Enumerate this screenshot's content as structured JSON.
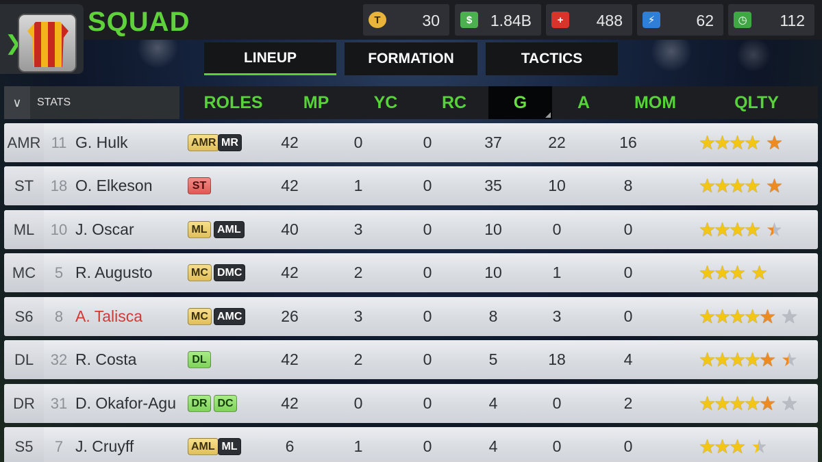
{
  "header": {
    "title": "SQUAD",
    "back_icon": "chevron-right-icon",
    "resources": [
      {
        "icon": "token-icon",
        "value": "30",
        "color": "#e8b53a"
      },
      {
        "icon": "cash-icon",
        "value": "1.84B",
        "color": "#4caf50"
      },
      {
        "icon": "medical-icon",
        "value": "488",
        "color": "#d9342b"
      },
      {
        "icon": "energy-icon",
        "value": "62",
        "color": "#2f7fd8"
      },
      {
        "icon": "training-icon",
        "value": "112",
        "color": "#3fa845"
      }
    ]
  },
  "tabs": [
    {
      "label": "LINEUP",
      "active": true
    },
    {
      "label": "FORMATION",
      "active": false
    },
    {
      "label": "TACTICS",
      "active": false
    }
  ],
  "stats_toggle": {
    "label": "STATS",
    "icon": "chevron-down-icon"
  },
  "columns": [
    "ROLES",
    "MP",
    "YC",
    "RC",
    "G",
    "A",
    "MOM",
    "QLTY"
  ],
  "sorted_column": "G",
  "players": [
    {
      "pos": "AMR",
      "num": "11",
      "name": "G. Hulk",
      "highlight": false,
      "roles": [
        {
          "label": "AMR",
          "style": "yellow"
        },
        {
          "label": "MR",
          "style": "dark"
        }
      ],
      "mp": "42",
      "yc": "0",
      "rc": "0",
      "g": "37",
      "a": "22",
      "mom": "16",
      "stars": [
        "gold",
        "gold",
        "gold",
        "gold",
        "gap",
        "orange"
      ]
    },
    {
      "pos": "ST",
      "num": "18",
      "name": "O. Elkeson",
      "highlight": false,
      "roles": [
        {
          "label": "ST",
          "style": "red"
        }
      ],
      "mp": "42",
      "yc": "1",
      "rc": "0",
      "g": "35",
      "a": "10",
      "mom": "8",
      "stars": [
        "gold",
        "gold",
        "gold",
        "gold",
        "gap",
        "orange"
      ]
    },
    {
      "pos": "ML",
      "num": "10",
      "name": "J. Oscar",
      "highlight": false,
      "roles": [
        {
          "label": "ML",
          "style": "yellow"
        },
        {
          "label": "AML",
          "style": "dark"
        }
      ],
      "mp": "40",
      "yc": "3",
      "rc": "0",
      "g": "10",
      "a": "0",
      "mom": "0",
      "stars": [
        "gold",
        "gold",
        "gold",
        "gold",
        "gap",
        "half"
      ]
    },
    {
      "pos": "MC",
      "num": "5",
      "name": "R. Augusto",
      "highlight": false,
      "roles": [
        {
          "label": "MC",
          "style": "yellow"
        },
        {
          "label": "DMC",
          "style": "dark"
        }
      ],
      "mp": "42",
      "yc": "2",
      "rc": "0",
      "g": "10",
      "a": "1",
      "mom": "0",
      "stars": [
        "gold",
        "gold",
        "gold",
        "gap",
        "gold"
      ]
    },
    {
      "pos": "S6",
      "num": "8",
      "name": "A. Talisca",
      "highlight": true,
      "roles": [
        {
          "label": "MC",
          "style": "yellow"
        },
        {
          "label": "AMC",
          "style": "dark"
        }
      ],
      "mp": "26",
      "yc": "3",
      "rc": "0",
      "g": "8",
      "a": "3",
      "mom": "0",
      "stars": [
        "gold",
        "gold",
        "gold",
        "gold",
        "orange",
        "gap",
        "grey"
      ]
    },
    {
      "pos": "DL",
      "num": "32",
      "name": "R. Costa",
      "highlight": false,
      "roles": [
        {
          "label": "DL",
          "style": "green"
        }
      ],
      "mp": "42",
      "yc": "2",
      "rc": "0",
      "g": "5",
      "a": "18",
      "mom": "4",
      "stars": [
        "gold",
        "gold",
        "gold",
        "gold",
        "orange",
        "gap",
        "half"
      ]
    },
    {
      "pos": "DR",
      "num": "31",
      "name": "D. Okafor-Agu",
      "highlight": false,
      "roles": [
        {
          "label": "DR",
          "style": "green"
        },
        {
          "label": "DC",
          "style": "green"
        }
      ],
      "mp": "42",
      "yc": "0",
      "rc": "0",
      "g": "4",
      "a": "0",
      "mom": "2",
      "stars": [
        "gold",
        "gold",
        "gold",
        "gold",
        "orange",
        "gap",
        "grey"
      ]
    },
    {
      "pos": "S5",
      "num": "7",
      "name": "J. Cruyff",
      "highlight": false,
      "roles": [
        {
          "label": "AML",
          "style": "yellow"
        },
        {
          "label": "ML",
          "style": "dark"
        }
      ],
      "mp": "6",
      "yc": "1",
      "rc": "0",
      "g": "4",
      "a": "0",
      "mom": "0",
      "stars": [
        "gold",
        "gold",
        "gold",
        "gap",
        "half-gold"
      ]
    }
  ]
}
